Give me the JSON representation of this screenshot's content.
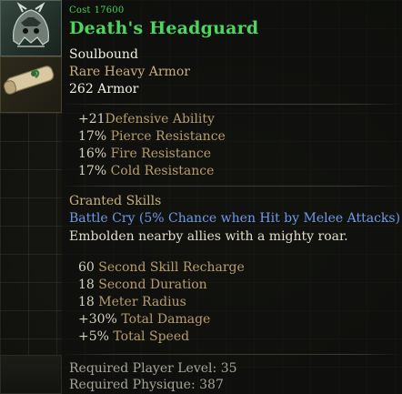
{
  "item": {
    "cost_label": "Cost",
    "cost_value": "17600",
    "name": "Death's Headguard",
    "binding": "Soulbound",
    "rarity_type": "Rare Heavy Armor",
    "armor": "262 Armor",
    "name_color": "#4cd65e"
  },
  "stats": [
    {
      "value": "+21",
      "text": "Defensive Ability"
    },
    {
      "value": "17%",
      "text": "Pierce Resistance"
    },
    {
      "value": "16%",
      "text": "Fire Resistance"
    },
    {
      "value": "17%",
      "text": "Cold Resistance"
    }
  ],
  "granted": {
    "header": "Granted Skills",
    "skill_name": "Battle Cry (5% Chance when Hit by Melee Attacks)",
    "description": "Embolden nearby allies with a mighty roar.",
    "skill_stats": [
      {
        "value": "60",
        "text": "Second Skill Recharge"
      },
      {
        "value": "18",
        "text": "Second Duration"
      },
      {
        "value": "18",
        "text": "Meter Radius"
      },
      {
        "value": "+30%",
        "text": "Total Damage"
      },
      {
        "value": "+5%",
        "text": "Total Speed"
      }
    ]
  },
  "requirements": [
    {
      "label": "Required Player Level:",
      "value": "35"
    },
    {
      "label": "Required Physique:",
      "value": "387"
    }
  ],
  "icons": {
    "helm": "helmet-icon",
    "scroll": "scroll-icon"
  }
}
